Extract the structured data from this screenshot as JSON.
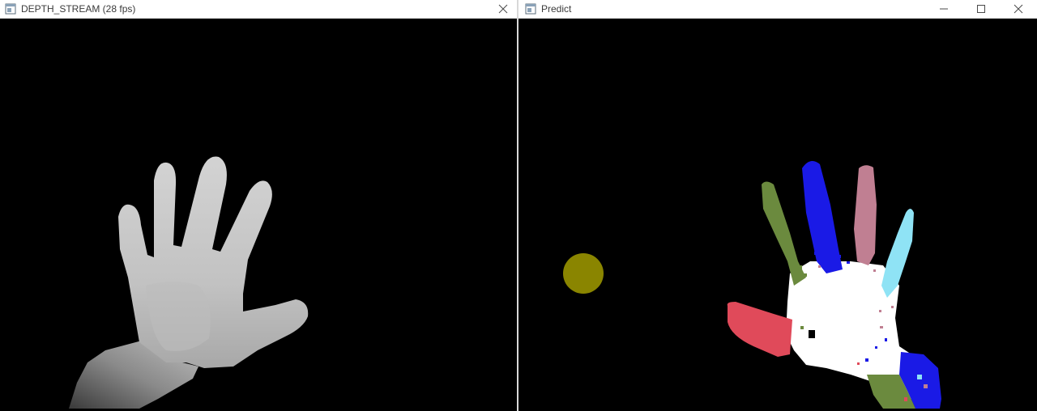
{
  "windows": {
    "depth": {
      "title": "DEPTH_STREAM (28 fps)",
      "icon": "app-window-icon",
      "controls": [
        "close-icon"
      ],
      "view": "depth-map-hand"
    },
    "predict": {
      "title": "Predict",
      "icon": "app-window-icon",
      "controls": [
        "minimize-icon",
        "maximize-icon",
        "close-icon"
      ],
      "view": "segmentation-hand",
      "colors": {
        "background": "#000000",
        "palm": "#ffffff",
        "thumb": "#e04a5a",
        "index": "#6b8a3e",
        "middle": "#1a1ae6",
        "ring": "#c07f92",
        "pinky": "#8fe3f5",
        "wrist": "#1a1ae6",
        "marker": "#8a8500"
      }
    }
  }
}
